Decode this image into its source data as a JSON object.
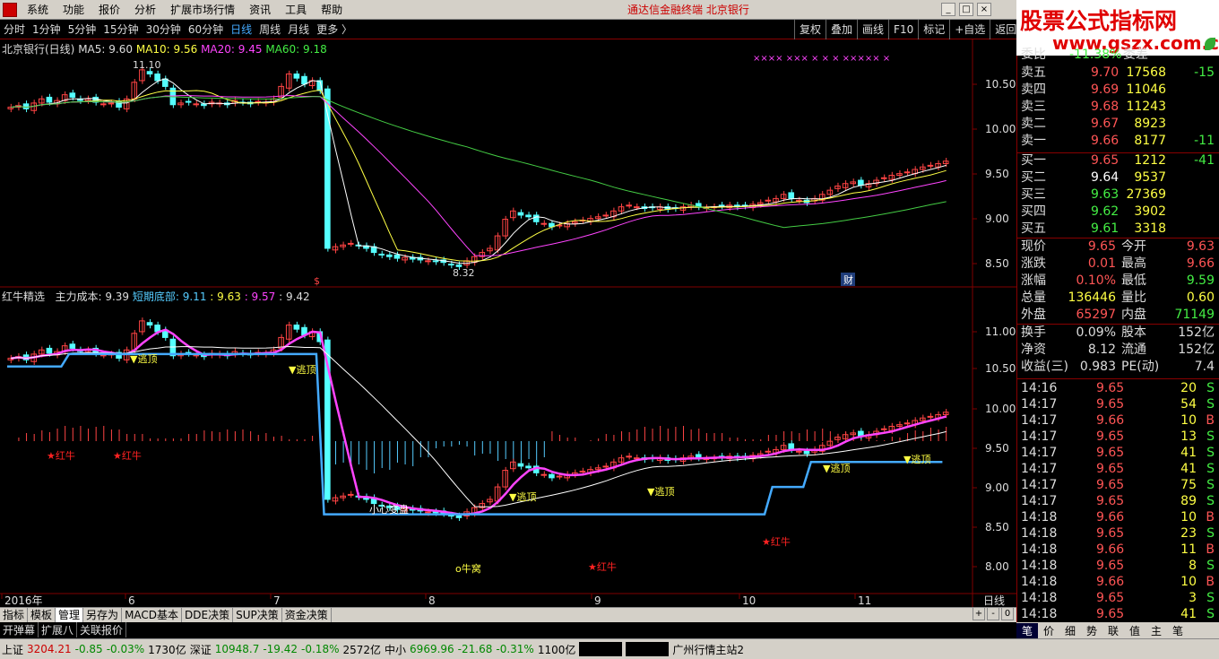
{
  "menu": {
    "items": [
      "系统",
      "功能",
      "报价",
      "分析",
      "扩展市场行情",
      "资讯",
      "工具",
      "帮助"
    ],
    "brand": "通达信金融终端  北京银行"
  },
  "banner": {
    "title": "股票公式指标网",
    "url": "www.gszx.com.cn"
  },
  "periods": [
    "分时",
    "1分钟",
    "5分钟",
    "15分钟",
    "30分钟",
    "60分钟",
    "日线",
    "周线",
    "月线",
    "更多 〉"
  ],
  "active_period": "日线",
  "right_tools": [
    "复权",
    "叠加",
    "画线",
    "F10",
    "标记",
    "+自选",
    "返回"
  ],
  "main_chart": {
    "title": "北京银行(日线)",
    "ma5": "MA5: 9.60",
    "ma10": "MA10: 9.56",
    "ma20": "MA20: 9.45",
    "ma60": "MA60: 9.18",
    "yticks": [
      "10.50",
      "10.00",
      "9.50",
      "9.00",
      "8.50"
    ],
    "high_label": "11.10",
    "low_label": "8.32",
    "marks": "××××   ×××   ×  ×  ×  ×××××   ×",
    "cai_label": "财",
    "dollar_label": "$"
  },
  "sub_chart": {
    "title": "红牛精选",
    "cost_label": "主力成本: 9.39",
    "bottom_label": "短期底部: 9.11",
    "v3": ": 9.63",
    "v4": ": 9.57",
    "v5": ": 9.42",
    "yticks": [
      "11.00",
      "10.50",
      "10.00",
      "9.50",
      "9.00",
      "8.50",
      "8.00"
    ],
    "escape": "▼逃顶",
    "redbull": "★红牛",
    "careful": "小心变盘",
    "niuwo": "o牛窝"
  },
  "chart_data": {
    "type": "candlestick",
    "title": "北京银行(日线)",
    "x_labels": [
      "2016年",
      "6",
      "7",
      "8",
      "9",
      "10",
      "11"
    ],
    "y_range": [
      8.2,
      10.9
    ],
    "ma": {
      "MA5": 9.6,
      "MA10": 9.56,
      "MA20": 9.45,
      "MA60": 9.18
    },
    "high": 11.1,
    "low": 8.32,
    "closes": [
      10.3,
      10.32,
      10.28,
      10.35,
      10.4,
      10.36,
      10.38,
      10.45,
      10.42,
      10.38,
      10.4,
      10.36,
      10.34,
      10.35,
      10.3,
      10.4,
      10.6,
      10.75,
      10.7,
      10.62,
      10.55,
      10.33,
      10.35,
      10.36,
      10.34,
      10.32,
      10.36,
      10.35,
      10.33,
      10.38,
      10.36,
      10.34,
      10.37,
      10.36,
      10.4,
      10.55,
      10.7,
      10.65,
      10.58,
      10.62,
      10.5,
      8.6,
      8.62,
      8.64,
      8.66,
      8.63,
      8.6,
      8.55,
      8.52,
      8.5,
      8.48,
      8.49,
      8.47,
      8.46,
      8.45,
      8.44,
      8.43,
      8.4,
      8.38,
      8.45,
      8.5,
      8.55,
      8.6,
      8.75,
      8.95,
      9.05,
      9.0,
      8.98,
      8.92,
      8.9,
      8.86,
      8.88,
      8.9,
      8.92,
      8.94,
      8.96,
      8.98,
      9.0,
      9.05,
      9.1,
      9.12,
      9.1,
      9.08,
      9.09,
      9.1,
      9.07,
      9.08,
      9.1,
      9.12,
      9.1,
      9.09,
      9.1,
      9.11,
      9.12,
      9.1,
      9.11,
      9.13,
      9.15,
      9.18,
      9.2,
      9.25,
      9.2,
      9.18,
      9.15,
      9.2,
      9.25,
      9.3,
      9.35,
      9.38,
      9.4,
      9.36,
      9.38,
      9.42,
      9.45,
      9.48,
      9.5,
      9.52,
      9.55,
      9.58,
      9.6,
      9.62,
      9.65
    ]
  },
  "quote": {
    "weibi": "委比",
    "weibi_val": "-11.38%",
    "weicha": "委差",
    "asks": [
      {
        "label": "卖五",
        "price": "9.70",
        "vol": "17568",
        "chg": "-15"
      },
      {
        "label": "卖四",
        "price": "9.69",
        "vol": "11046",
        "chg": ""
      },
      {
        "label": "卖三",
        "price": "9.68",
        "vol": "11243",
        "chg": ""
      },
      {
        "label": "卖二",
        "price": "9.67",
        "vol": "8923",
        "chg": ""
      },
      {
        "label": "卖一",
        "price": "9.66",
        "vol": "8177",
        "chg": "-11"
      }
    ],
    "bids": [
      {
        "label": "买一",
        "price": "9.65",
        "vol": "1212",
        "chg": "-41"
      },
      {
        "label": "买二",
        "price": "9.64",
        "vol": "9537",
        "chg": ""
      },
      {
        "label": "买三",
        "price": "9.63",
        "vol": "27369",
        "chg": ""
      },
      {
        "label": "买四",
        "price": "9.62",
        "vol": "3902",
        "chg": ""
      },
      {
        "label": "买五",
        "price": "9.61",
        "vol": "3318",
        "chg": ""
      }
    ],
    "stats": [
      {
        "k1": "现价",
        "v1": "9.65",
        "k2": "今开",
        "v2": "9.63"
      },
      {
        "k1": "涨跌",
        "v1": "0.01",
        "k2": "最高",
        "v2": "9.66"
      },
      {
        "k1": "涨幅",
        "v1": "0.10%",
        "k2": "最低",
        "v2": "9.59"
      },
      {
        "k1": "总量",
        "v1": "136446",
        "k2": "量比",
        "v2": "0.60"
      },
      {
        "k1": "外盘",
        "v1": "65297",
        "k2": "内盘",
        "v2": "71149"
      }
    ],
    "stats2": [
      {
        "k1": "换手",
        "v1": "0.09%",
        "k2": "股本",
        "v2": "152亿"
      },
      {
        "k1": "净资",
        "v1": "8.12",
        "k2": "流通",
        "v2": "152亿"
      },
      {
        "k1": "收益(三)",
        "v1": "0.983",
        "k2": "PE(动)",
        "v2": "7.4"
      }
    ],
    "ticks": [
      {
        "t": "14:16",
        "p": "9.65",
        "v": "20",
        "s": "S"
      },
      {
        "t": "14:17",
        "p": "9.65",
        "v": "54",
        "s": "S"
      },
      {
        "t": "14:17",
        "p": "9.66",
        "v": "10",
        "s": "B"
      },
      {
        "t": "14:17",
        "p": "9.65",
        "v": "13",
        "s": "S"
      },
      {
        "t": "14:17",
        "p": "9.65",
        "v": "41",
        "s": "S"
      },
      {
        "t": "14:17",
        "p": "9.65",
        "v": "41",
        "s": "S"
      },
      {
        "t": "14:17",
        "p": "9.65",
        "v": "75",
        "s": "S"
      },
      {
        "t": "14:17",
        "p": "9.65",
        "v": "89",
        "s": "S"
      },
      {
        "t": "14:18",
        "p": "9.66",
        "v": "10",
        "s": "B"
      },
      {
        "t": "14:18",
        "p": "9.65",
        "v": "23",
        "s": "S"
      },
      {
        "t": "14:18",
        "p": "9.66",
        "v": "11",
        "s": "B"
      },
      {
        "t": "14:18",
        "p": "9.65",
        "v": "8",
        "s": "S"
      },
      {
        "t": "14:18",
        "p": "9.66",
        "v": "10",
        "s": "B"
      },
      {
        "t": "14:18",
        "p": "9.65",
        "v": "3",
        "s": "S"
      },
      {
        "t": "14:18",
        "p": "9.65",
        "v": "41",
        "s": "S"
      }
    ]
  },
  "bottom_tabs": [
    "指标",
    "模板",
    "管理",
    "另存为",
    "MACD基本",
    "DDE决策",
    "SUP决策",
    "资金决策"
  ],
  "bottom_tabs2": [
    "开弹幕",
    "扩展八",
    "关联报价"
  ],
  "period_label": "日线",
  "rp_tabs": [
    "笔",
    "价",
    "细",
    "势",
    "联",
    "值",
    "主",
    "笔"
  ],
  "status": {
    "sh": "上证",
    "sh_v": "3204.21",
    "sh_c": "-0.85",
    "sh_p": "-0.03%",
    "sh_a": "1730亿",
    "sz": "深证",
    "sz_v": "10948.7",
    "sz_c": "-19.42",
    "sz_p": "-0.18%",
    "sz_a": "2572亿",
    "zx": "中小",
    "zx_v": "6969.96",
    "zx_c": "-21.68",
    "zx_p": "-0.31%",
    "zx_a": "1100亿",
    "server": "广州行情主站2"
  },
  "colors": {
    "up": "#ff4444",
    "down": "#44ee44",
    "ma5": "#ffffff",
    "ma10": "#ffff44",
    "ma20": "#ff44ff",
    "ma60": "#44cc44",
    "base": "#44aaff",
    "axis": "#800000"
  }
}
